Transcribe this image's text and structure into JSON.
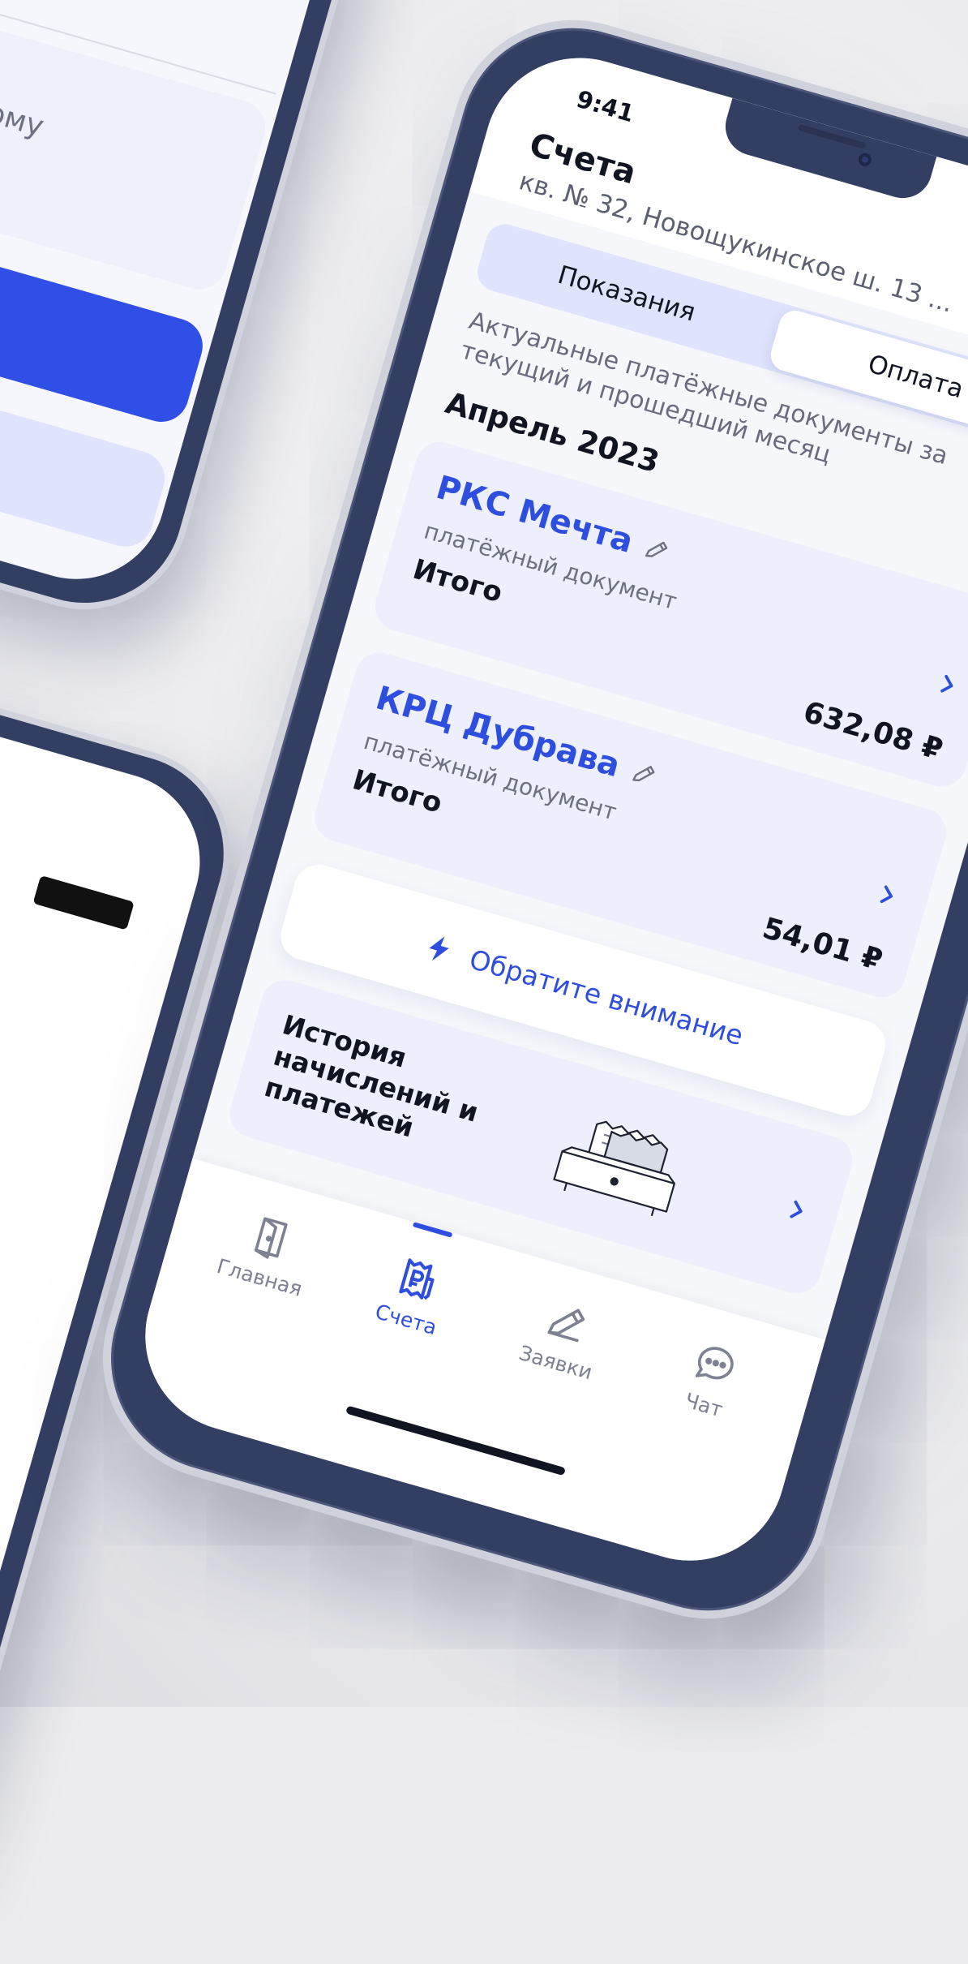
{
  "background_phone": {
    "card_text": "ы по платёжному"
  },
  "status_bar": {
    "time": "9:41"
  },
  "header": {
    "title": "Счета",
    "address": "кв. № 32, Новощукинское ш. 13 ..."
  },
  "tabs": [
    {
      "label": "Показания",
      "active": false
    },
    {
      "label": "Оплата",
      "active": true
    }
  ],
  "hint": "Актуальные платёжные документы за текущий и прошедший месяц",
  "month": "Апрель 2023",
  "documents": [
    {
      "org": "РКС Мечта",
      "type": "платёжный документ",
      "total_label": "Итого",
      "amount": "632,08 ₽"
    },
    {
      "org": "КРЦ Дубрава",
      "type": "платёжный документ",
      "total_label": "Итого",
      "amount": "54,01 ₽"
    }
  ],
  "notice": {
    "label": "Обратите внимание",
    "icon": "lightning-icon"
  },
  "history": {
    "label": "История начислений и платежей",
    "icon": "receipt-drawer-illustration"
  },
  "tabbar": [
    {
      "label": "Главная",
      "icon": "door-icon",
      "active": false
    },
    {
      "label": "Счета",
      "icon": "receipt-ruble-icon",
      "active": true
    },
    {
      "label": "Заявки",
      "icon": "pencil-icon",
      "active": false
    },
    {
      "label": "Чат",
      "icon": "chat-bubble-icon",
      "active": false
    }
  ],
  "colors": {
    "accent": "#2e4ee0",
    "frame": "#333f62",
    "card": "#edf0fc",
    "tab_track": "#dfe3fb"
  }
}
